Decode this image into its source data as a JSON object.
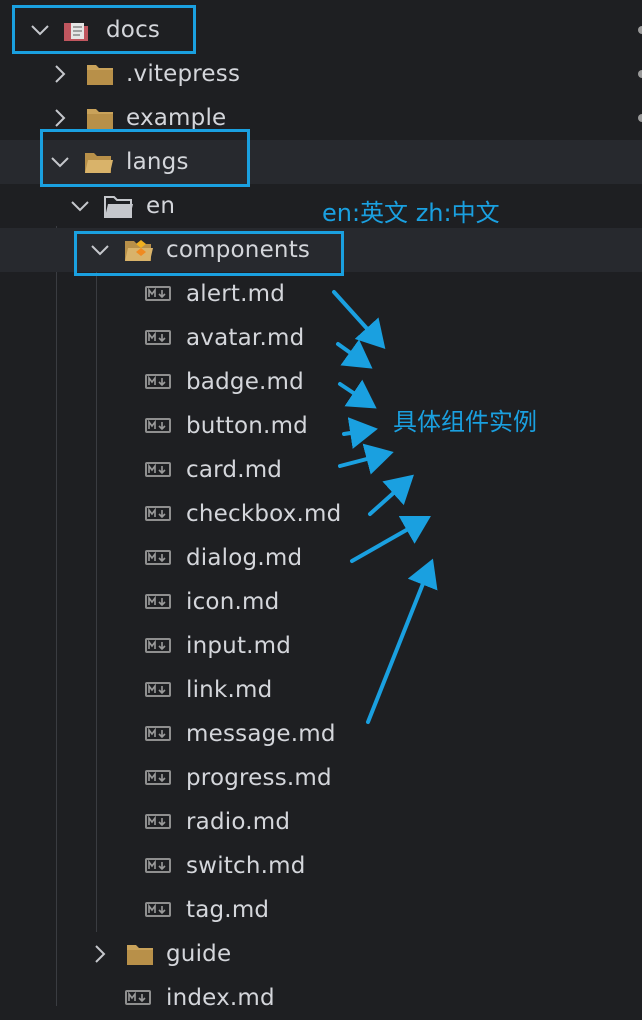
{
  "tree": {
    "docs": "docs",
    "vitepress": ".vitepress",
    "example": "example",
    "langs": "langs",
    "en": "en",
    "components": "components",
    "files": [
      "alert.md",
      "avatar.md",
      "badge.md",
      "button.md",
      "card.md",
      "checkbox.md",
      "dialog.md",
      "icon.md",
      "input.md",
      "link.md",
      "message.md",
      "progress.md",
      "radio.md",
      "switch.md",
      "tag.md"
    ],
    "guide": "guide",
    "index": "index.md"
  },
  "annotations": {
    "lang_note": "en:英文  zh:中文",
    "components_note": "具体组件实例"
  },
  "icons": {
    "chevron_expanded": "chevron-down-icon",
    "chevron_collapsed": "chevron-right-icon",
    "folder": "folder-icon",
    "folder_open": "folder-open-icon",
    "docs_folder": "docs-folder-icon",
    "components_folder": "components-folder-icon",
    "markdown": "markdown-file-icon"
  },
  "colors": {
    "background": "#1e1f22",
    "selected_row": "#27292e",
    "text": "#d4d6db",
    "annotation": "#1aa0e0",
    "folder": "#c9a25a"
  }
}
